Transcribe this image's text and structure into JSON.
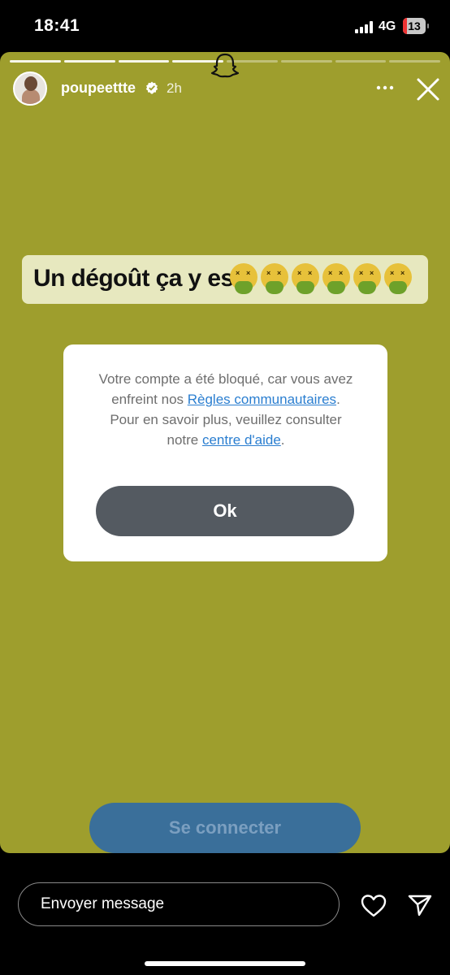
{
  "status": {
    "time": "18:41",
    "network": "4G",
    "battery": "13"
  },
  "story": {
    "username": "poupeettte",
    "time_ago": "2h",
    "caption": "Un dégoût ça y est",
    "emoji_count": 6,
    "emoji": "nauseated-face"
  },
  "dialog": {
    "text_1": "Votre compte a été bloqué, car vous avez enfreint nos ",
    "link_rules": "Règles communautaires",
    "text_2": ". Pour en savoir plus, veuillez consulter notre ",
    "link_help": "centre d'aide",
    "text_3": ".",
    "ok_label": "Ok"
  },
  "connect_label": "Se connecter",
  "message_placeholder": "Envoyer message",
  "colors": {
    "story_bg": "#9e9e2d",
    "link": "#2a7ed0",
    "ok_button": "#545a61"
  }
}
